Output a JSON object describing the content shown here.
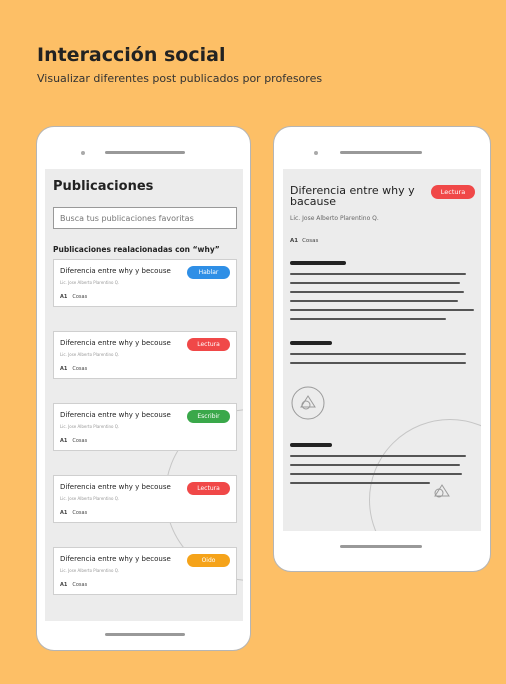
{
  "header": {
    "title": "Interacción social",
    "subtitle": "Visualizar diferentes post publicados por profesores"
  },
  "left_phone": {
    "screen_title": "Publicaciones",
    "search_placeholder": "Busca tus publicaciones favoritas",
    "related_label": "Publicaciones realacionadas con “why”",
    "cards": [
      {
        "title": "Diferencia entre why y becouse",
        "author": "Lic. Jose Alberto Plarentino Q.",
        "level": "A1",
        "category": "Cosas",
        "badge": "Hablar",
        "badge_color": "#2f8fe6"
      },
      {
        "title": "Diferencia entre why y becouse",
        "author": "Lic. Jose Alberto Plarentino Q.",
        "level": "A1",
        "category": "Cosas",
        "badge": "Lectura",
        "badge_color": "#f04848"
      },
      {
        "title": "Diferencia entre why y becouse",
        "author": "Lic. Jose Alberto Plarentino Q.",
        "level": "A1",
        "category": "Cosas",
        "badge": "Escribir",
        "badge_color": "#3aa84a"
      },
      {
        "title": "Diferencia entre why y becouse",
        "author": "Lic. Jose Alberto Plarentino Q.",
        "level": "A1",
        "category": "Cosas",
        "badge": "Lectura",
        "badge_color": "#f04848"
      },
      {
        "title": "Diferencia entre why y becouse",
        "author": "Lic. Jose Alberto Plarentino Q.",
        "level": "A1",
        "category": "Cosas",
        "badge": "Oido",
        "badge_color": "#f5a31a"
      }
    ]
  },
  "right_phone": {
    "article_title": "Diferencia entre why y bacause",
    "badge": "Lectura",
    "badge_color": "#f04848",
    "author": "Lic. Jose Alberto Plarentino Q.",
    "level": "A1",
    "category": "Cosas"
  }
}
